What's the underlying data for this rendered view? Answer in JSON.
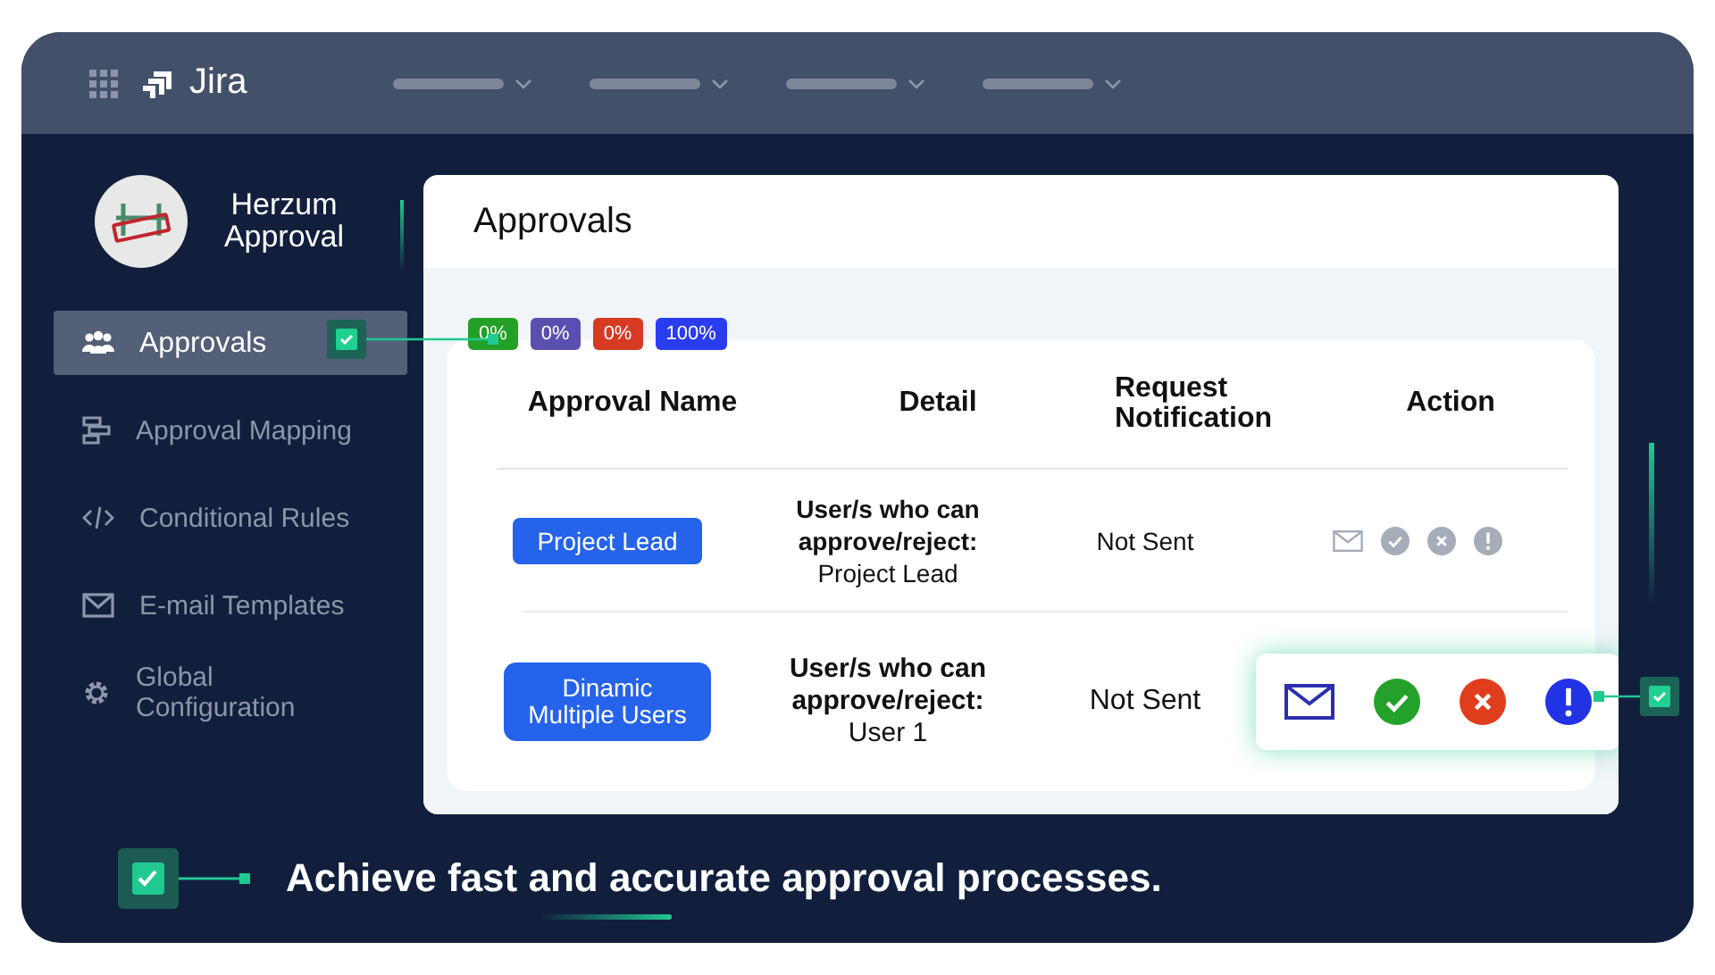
{
  "app": {
    "name": "Jira"
  },
  "sidebar": {
    "logo_title": "Herzum Approval",
    "items": [
      {
        "label": "Approvals",
        "kind": "people",
        "selected": true
      },
      {
        "label": "Approval Mapping",
        "kind": "mapping",
        "selected": false
      },
      {
        "label": "Conditional Rules",
        "kind": "code",
        "selected": false
      },
      {
        "label": "E-mail Templates",
        "kind": "mail",
        "selected": false
      },
      {
        "label": "Global Configuration",
        "kind": "gear",
        "selected": false
      }
    ]
  },
  "panel": {
    "title": "Approvals",
    "badges": [
      {
        "label": "0%",
        "color": "#23a127"
      },
      {
        "label": "0%",
        "color": "#5a4fb0"
      },
      {
        "label": "0%",
        "color": "#d63a22"
      },
      {
        "label": "100%",
        "color": "#2a3cf0"
      }
    ],
    "table": {
      "columns": [
        "Approval Name",
        "Detail",
        "Request Notification",
        "Action"
      ],
      "rows": [
        {
          "name": "Project Lead",
          "detail_label": "User/s who can approve/reject:",
          "detail_value": "Project Lead",
          "notification": "Not Sent",
          "highlighted": false
        },
        {
          "name": "Dinamic Multiple Users",
          "detail_label": "User/s who can approve/reject:",
          "detail_value": "User 1",
          "notification": "Not Sent",
          "highlighted": true
        }
      ]
    }
  },
  "tagline": "Achieve fast and accurate approval processes."
}
